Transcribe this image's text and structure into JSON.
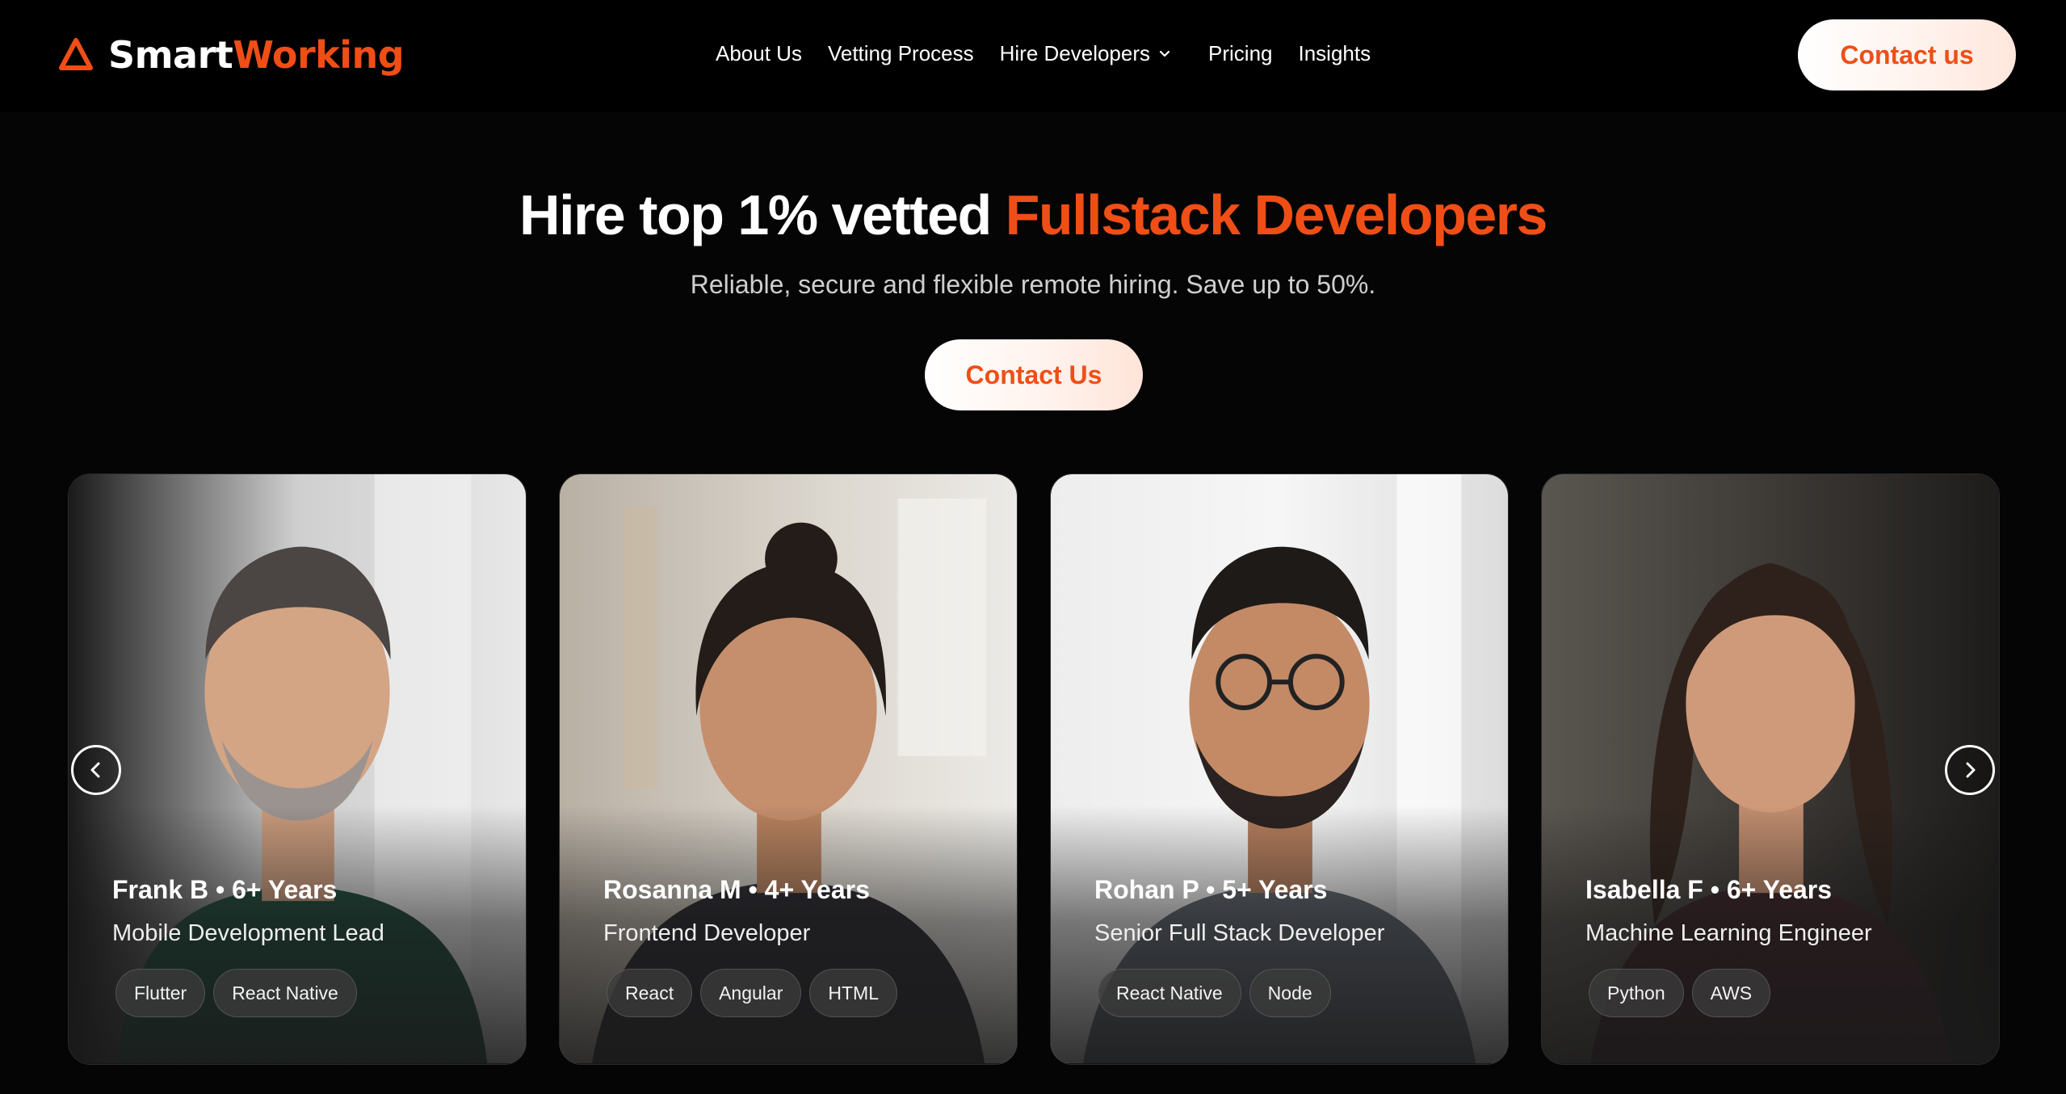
{
  "brand": {
    "name_part1": "Smart",
    "name_part2": "Working",
    "accent_color": "#f04e16"
  },
  "nav": {
    "items": [
      "About Us",
      "Vetting Process",
      "Hire Developers",
      "Pricing",
      "Insights"
    ],
    "header_cta": "Contact us"
  },
  "hero": {
    "title_prefix": "Hire top 1% vetted ",
    "title_accent": "Fullstack Developers",
    "subtitle": "Reliable, secure and flexible remote hiring. Save up to 50%.",
    "cta": "Contact Us"
  },
  "carousel": {
    "prev_icon": "chevron-left-icon",
    "next_icon": "chevron-right-icon",
    "cards": [
      {
        "name": "Frank B • 6+ Years",
        "role": "Mobile Development Lead",
        "tags": [
          "Flutter",
          "React Native"
        ]
      },
      {
        "name": "Rosanna M • 4+ Years",
        "role": "Frontend Developer",
        "tags": [
          "React",
          "Angular",
          "HTML"
        ]
      },
      {
        "name": "Rohan P • 5+ Years",
        "role": "Senior Full Stack Developer",
        "tags": [
          "React Native",
          "Node"
        ]
      },
      {
        "name": "Isabella F • 6+ Years",
        "role": "Machine Learning Engineer",
        "tags": [
          "Python",
          "AWS"
        ]
      }
    ]
  }
}
